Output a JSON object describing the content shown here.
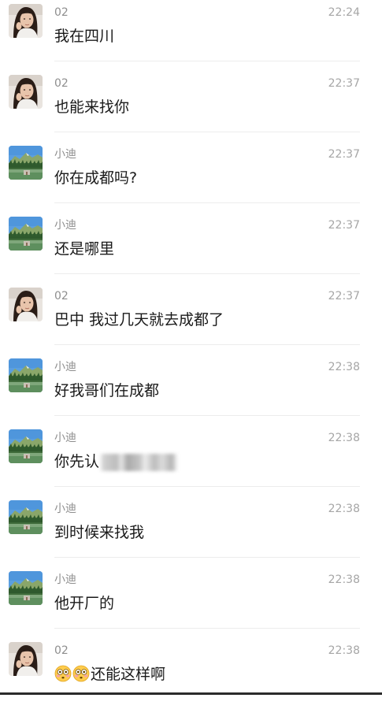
{
  "messages": [
    {
      "sender": "02",
      "time": "22:24",
      "text": "我在四川",
      "avatar": "portrait-avatar"
    },
    {
      "sender": "02",
      "time": "22:37",
      "text": "也能来找你",
      "avatar": "portrait-avatar"
    },
    {
      "sender": "小迪",
      "time": "22:37",
      "text": "你在成都吗?",
      "avatar": "landscape-avatar"
    },
    {
      "sender": "小迪",
      "time": "22:37",
      "text": "还是哪里",
      "avatar": "landscape-avatar"
    },
    {
      "sender": "02",
      "time": "22:37",
      "text": "巴中 我过几天就去成都了",
      "avatar": "portrait-avatar"
    },
    {
      "sender": "小迪",
      "time": "22:38",
      "text": "好我哥们在成都",
      "avatar": "landscape-avatar"
    },
    {
      "sender": "小迪",
      "time": "22:38",
      "text": "你先认",
      "avatar": "landscape-avatar"
    },
    {
      "sender": "小迪",
      "time": "22:38",
      "text": "到时候来找我",
      "avatar": "landscape-avatar"
    },
    {
      "sender": "小迪",
      "time": "22:38",
      "text": "他开厂的",
      "avatar": "landscape-avatar"
    },
    {
      "sender": "02",
      "time": "22:38",
      "text": "还能这样啊",
      "avatar": "portrait-avatar"
    }
  ],
  "colors": {
    "name": "#8e8e8e",
    "time": "#a6a6a6",
    "text": "#1a1a1a",
    "divider": "#ececec"
  }
}
